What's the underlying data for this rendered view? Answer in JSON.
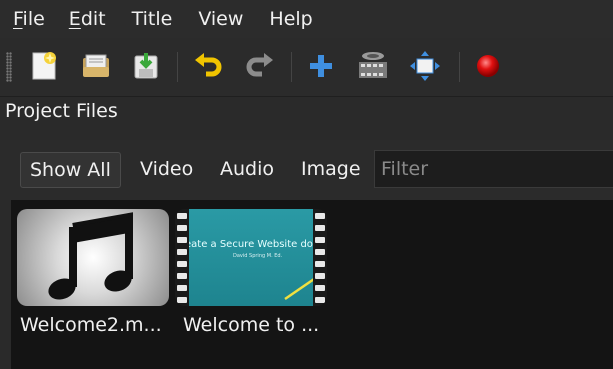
{
  "menu": {
    "file_first": "F",
    "file_rest": "ile",
    "edit_first": "E",
    "edit_rest": "dit",
    "title": "Title",
    "view": "View",
    "help": "Help"
  },
  "toolbar": {
    "icons": [
      "new-project-icon",
      "open-project-icon",
      "save-project-icon",
      "undo-icon",
      "redo-icon",
      "import-files-icon",
      "profile-icon",
      "fullscreen-icon",
      "record-icon"
    ]
  },
  "project_files": {
    "title": "Project Files",
    "tabs": {
      "all": "Show All",
      "video": "Video",
      "audio": "Audio",
      "image": "Image"
    },
    "filter_placeholder": "Filter",
    "items": [
      {
        "label": "Welcome2.m..."
      },
      {
        "label": "Welcome to ...",
        "thumb_title": "eate a Secure Website dot co",
        "thumb_sub": "David Spring M. Ed."
      }
    ]
  },
  "colors": {
    "record": "#e01010",
    "arrow_blue": "#3f8fe0",
    "undo_yellow": "#f0c400"
  }
}
